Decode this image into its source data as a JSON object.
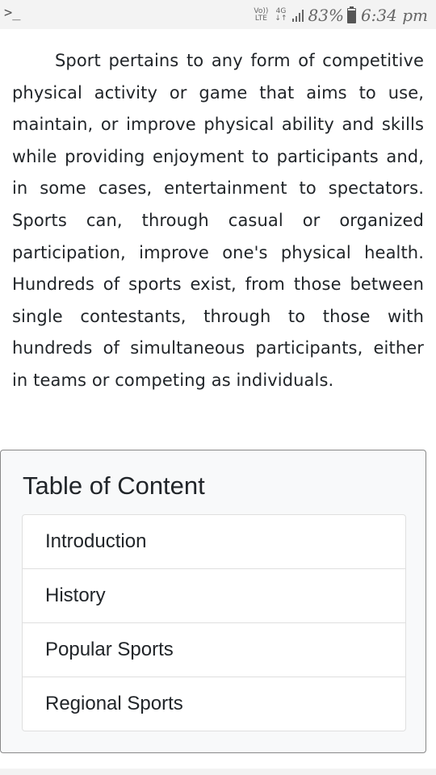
{
  "status_bar": {
    "volte_top": "Vo))",
    "volte_bottom": "LTE",
    "network_top": "4G",
    "network_bottom": "↓↑",
    "battery_percent": "83%",
    "battery_level": 0.83,
    "time": "6:34 pm",
    "icons": [
      "terminal-icon",
      "volte-icon",
      "4g-icon",
      "signal-icon",
      "battery-icon"
    ]
  },
  "article": {
    "paragraph": "Sport pertains to any form of competitive physical activity or game that aims to use, maintain, or improve physical ability and skills while providing enjoyment to participants and, in some cases, entertainment to spectators. Sports can, through casual or organized participation, improve one's physical health. Hundreds of sports exist, from those between single contestants, through to those with hundreds of simultaneous participants, either in teams or competing as individuals."
  },
  "toc": {
    "title": "Table of Content",
    "items": [
      {
        "label": "Introduction"
      },
      {
        "label": "History"
      },
      {
        "label": "Popular Sports"
      },
      {
        "label": "Regional Sports"
      }
    ]
  }
}
